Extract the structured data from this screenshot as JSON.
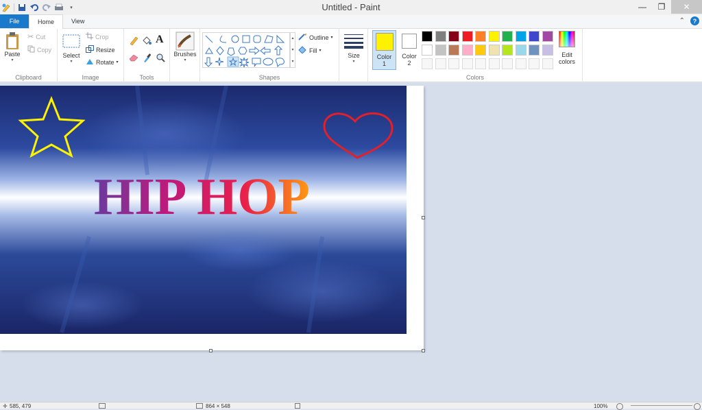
{
  "window": {
    "title": "Untitled - Paint"
  },
  "tabs": {
    "file": "File",
    "home": "Home",
    "view": "View"
  },
  "clipboard": {
    "paste": "Paste",
    "cut": "Cut",
    "copy": "Copy",
    "label": "Clipboard"
  },
  "image_group": {
    "select": "Select",
    "crop": "Crop",
    "resize": "Resize",
    "rotate": "Rotate",
    "label": "Image"
  },
  "tools": {
    "label": "Tools"
  },
  "brushes": {
    "label": "Brushes"
  },
  "shapes": {
    "outline": "Outline",
    "fill": "Fill",
    "label": "Shapes"
  },
  "size": {
    "label": "Size"
  },
  "colors": {
    "color1_label": "Color",
    "color1_num": "1",
    "color2_label": "Color",
    "color2_num": "2",
    "edit_line1": "Edit",
    "edit_line2": "colors",
    "label": "Colors",
    "color1": "#fff200",
    "color2": "#ffffff",
    "palette_row1": [
      "#000000",
      "#7f7f7f",
      "#880015",
      "#ed1c24",
      "#ff7f27",
      "#fff200",
      "#22b14c",
      "#00a2e8",
      "#3f48cc",
      "#a349a4"
    ],
    "palette_row2": [
      "#ffffff",
      "#c3c3c3",
      "#b97a57",
      "#ffaec9",
      "#ffc90e",
      "#efe4b0",
      "#b5e61d",
      "#99d9ea",
      "#7092be",
      "#c8bfe7"
    ]
  },
  "canvas_text": {
    "headline": "HIP HOP"
  },
  "status": {
    "cursor": "585, 479",
    "size": "864 × 548",
    "zoom": "100%"
  }
}
